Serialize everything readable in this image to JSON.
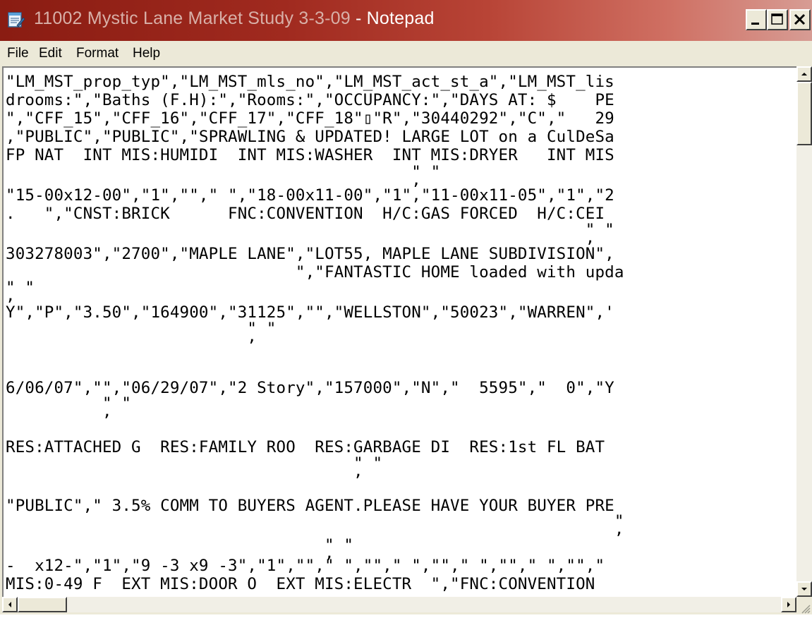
{
  "window": {
    "file_name": "11002 Mystic Lane Market Study 3-3-09",
    "app_suffix": " - Notepad"
  },
  "menu": [
    "File",
    "Edit",
    "Format",
    "Help"
  ],
  "editor": {
    "lines": [
      "\"LM_MST_prop_typ\",\"LM_MST_mls_no\",\"LM_MST_act_st_a\",\"LM_MST_lis",
      "drooms:\",\"Baths (F.H):\",\"Rooms:\",\"OCCUPANCY:\",\"DAYS AT: $    PE",
      "\",\"CFF_15\",\"CFF_16\",\"CFF_17\",\"CFF_18\"▯\"R\",\"30440292\",\"C\",\"   29",
      ",\"PUBLIC\",\"PUBLIC\",\"SPRAWLING & UPDATED! LARGE LOT on a CulDeSa",
      "FP NAT  INT MIS:HUMIDI  INT MIS:WASHER  INT MIS:DRYER   INT MIS",
      "                                          \" \"",
      "                                          ,",
      "\"15-00x12-00\",\"1\",\"\",\" \",\"18-00x11-00\",\"1\",\"11-00x11-05\",\"1\",\"2",
      ".   \",\"CNST:BRICK      FNC:CONVENTION  H/C:GAS FORCED  H/C:CEI",
      "                                                            \" \"",
      "                                                            ,",
      "303278003\",\"2700\",\"MAPLE LANE\",\"LOT55, MAPLE LANE SUBDIVISION\",",
      "                              \",\"FANTASTIC HOME loaded with upda",
      "\" \"",
      ",",
      "Y\",\"P\",\"3.50\",\"164900\",\"31125\",\"\",\"WELLSTON\",\"50023\",\"WARREN\",'",
      "                         \" \"",
      "                         ,",
      "6/06/07\",\"\",\"06/29/07\",\"2 Story\",\"157000\",\"N\",\"  5595\",\"  0\",\"Y",
      "          \" \"",
      "          ,",
      "RES:ATTACHED G  RES:FAMILY ROO  RES:GARBAGE DI  RES:1st FL BAT",
      "                                    \" \"",
      "                                    ,",
      "\"PUBLIC\",\" 3.5% COMM TO BUYERS AGENT.PLEASE HAVE YOUR BUYER PRE",
      "                                                               \"",
      "                                                               ,",
      "                                 \" \"",
      "                                 ,",
      "-  x12-\",\"1\",\"9 -3 x9 -3\",\"1\",\"\",\" \",\"\",\" \",\"\",\" \",\"\",\" \",\"\",\"",
      "MIS:0-49 F  EXT MIS:DOOR O  EXT MIS:ELECTR  \",\"FNC:CONVENTION"
    ]
  },
  "icons": {
    "app": "notepad-icon",
    "minimize": "minimize-icon",
    "maximize": "maximize-icon",
    "close": "close-icon",
    "scroll_up": "arrow-up-icon",
    "scroll_down": "arrow-down-icon",
    "scroll_left": "arrow-left-icon",
    "scroll_right": "arrow-right-icon"
  },
  "colors": {
    "title_start": "#8a1c12",
    "title_end": "#d79c94",
    "chrome": "#ece9d8"
  }
}
